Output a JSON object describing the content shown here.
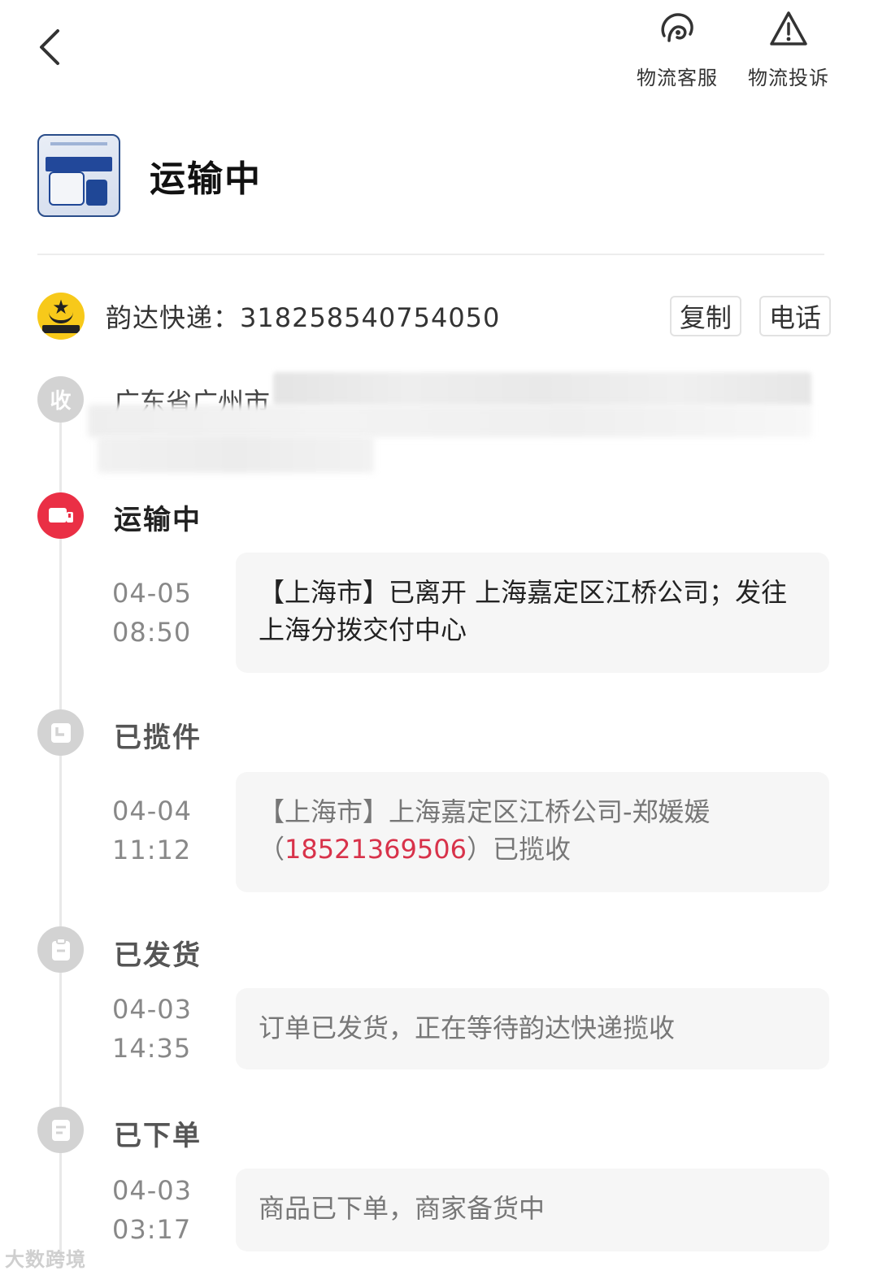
{
  "top_actions": {
    "service_label": "物流客服",
    "complaint_label": "物流投诉"
  },
  "header": {
    "status": "运输中"
  },
  "courier": {
    "text": "韵达快递：318258540754050",
    "copy_label": "复制",
    "phone_label": "电话",
    "logo_text": "韵达速递"
  },
  "receiver": {
    "node_label": "收",
    "address_visible": "广东省广州市"
  },
  "stages": [
    {
      "title": "运输中",
      "date": "04-05",
      "time": "08:50",
      "detail": "【上海市】已离开 上海嘉定区江桥公司；发往上海分拨交付中心"
    },
    {
      "title": "已揽件",
      "date": "04-04",
      "time": "11:12",
      "detail_prefix": "【上海市】上海嘉定区江桥公司-郑媛媛（",
      "detail_phone": "18521369506",
      "detail_suffix": "）已揽收"
    },
    {
      "title": "已发货",
      "date": "04-03",
      "time": "14:35",
      "detail": "订单已发货，正在等待韵达快递揽收"
    },
    {
      "title": "已下单",
      "date": "04-03",
      "time": "03:17",
      "detail": "商品已下单，商家备货中"
    }
  ],
  "watermark": "大数跨境",
  "colors": {
    "accent_red": "#ea2f45",
    "phone_red": "#d8324a",
    "node_grey": "#d3d3d3",
    "courier_yellow": "#f7c91a"
  }
}
